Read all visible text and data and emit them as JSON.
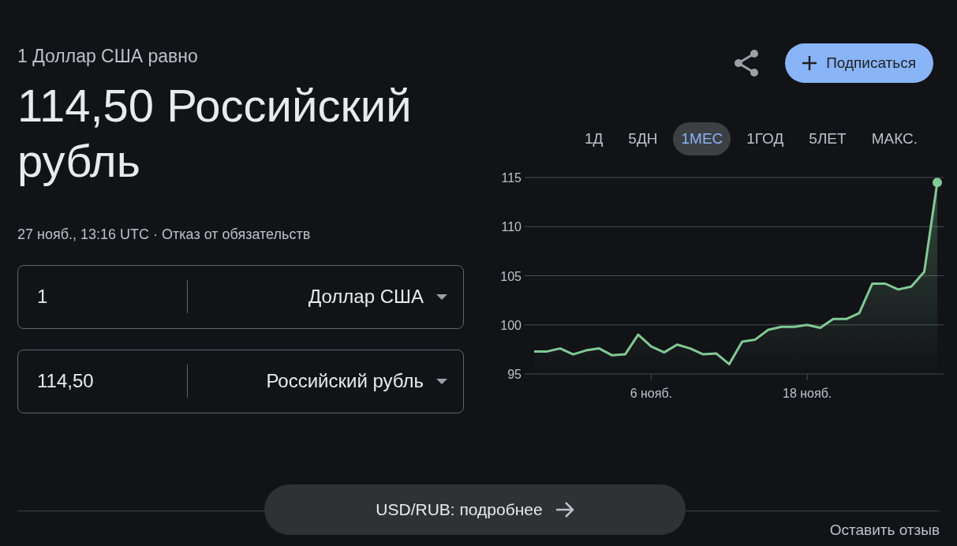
{
  "header": {
    "subtitle": "1 Доллар США равно",
    "value": "114,50 Российский рубль",
    "meta": "27 нояб., 13:16 UTC · ",
    "disclaimer": "Отказ от обязательств"
  },
  "converter": [
    {
      "amount": "1",
      "currency": "Доллар США"
    },
    {
      "amount": "114,50",
      "currency": "Российский рубль"
    }
  ],
  "subscribe_button": "Подписаться",
  "range_tabs": [
    {
      "label": "1Д",
      "selected": false
    },
    {
      "label": "5ДН",
      "selected": false
    },
    {
      "label": "1МЕС",
      "selected": true
    },
    {
      "label": "1ГОД",
      "selected": false
    },
    {
      "label": "5ЛЕТ",
      "selected": false
    },
    {
      "label": "МАКС.",
      "selected": false
    }
  ],
  "chart_data": {
    "type": "area",
    "categories": [
      null,
      null,
      null,
      null,
      null,
      null,
      null,
      null,
      null,
      "6 нояб.",
      null,
      null,
      null,
      null,
      null,
      null,
      null,
      null,
      null,
      null,
      null,
      "18 нояб.",
      null,
      null,
      null,
      null,
      null,
      null,
      null,
      null,
      null,
      null
    ],
    "series": [
      {
        "color": "#81c995",
        "values": [
          97.3,
          97.3,
          97.6,
          97.0,
          97.4,
          97.6,
          96.9,
          97.0,
          99.0,
          97.8,
          97.2,
          98.0,
          97.6,
          97.0,
          97.1,
          96.0,
          98.3,
          98.5,
          99.5,
          99.8,
          99.8,
          100.0,
          99.7,
          100.6,
          100.6,
          101.2,
          104.2,
          104.2,
          103.6,
          103.9,
          105.4,
          114.5
        ]
      }
    ],
    "ylim": [
      95,
      115
    ],
    "yticks": [
      95,
      100,
      105,
      110,
      115
    ],
    "grid": true
  },
  "details_button": "USD/RUB: подробнее",
  "feedback_link": "Оставить отзыв"
}
